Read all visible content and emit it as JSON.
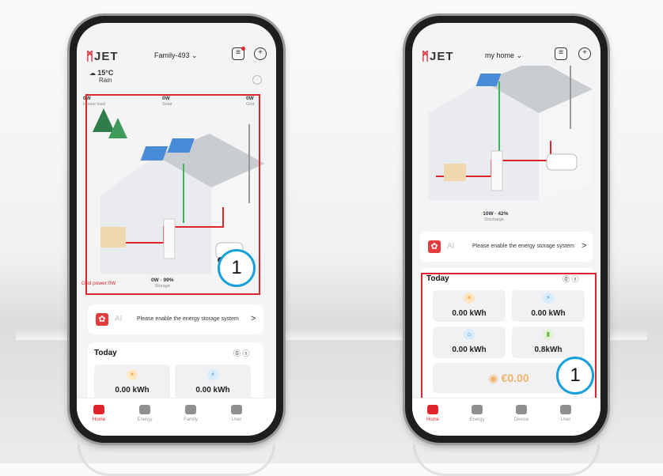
{
  "colors": {
    "accent": "#e0242c",
    "highlight_box": "#d9252e",
    "callout_ring": "#18a0d8",
    "solar_line": "#3fb45f"
  },
  "left": {
    "logo": "JET",
    "family": "Family-493",
    "weather": {
      "temp": "15°C",
      "cond": "Rain"
    },
    "flow": {
      "house_val": "0W",
      "house_lbl": "House load",
      "solar_val": "0W",
      "solar_lbl": "Solar",
      "grid_val": "0W",
      "grid_lbl": "Grid",
      "gridpower": "Grid power:0W",
      "storage_val": "0W · 99%",
      "storage_lbl": "Storage"
    },
    "callout": "1",
    "ai": {
      "label": "AI",
      "text": "Please enable the energy storage system",
      "chevron": ">"
    },
    "today": {
      "title": "Today",
      "stats": [
        "0.00 kWh",
        "0.00 kWh"
      ]
    },
    "nav": [
      "Home",
      "Energy",
      "Family",
      "User"
    ]
  },
  "right": {
    "logo": "JET",
    "family": "my home",
    "flow": {
      "storage_val": "10W · 42%",
      "storage_lbl": "Discharge"
    },
    "ai": {
      "label": "AI",
      "text": "Please enable the energy storage system",
      "chevron": ">"
    },
    "today": {
      "title": "Today",
      "stats": [
        "0.00 kWh",
        "0.00 kWh",
        "0.00 kWh",
        "0.8kWh"
      ],
      "money": "€0.00"
    },
    "callout": "1",
    "nav": [
      "Home",
      "Energy",
      "Device",
      "User"
    ]
  }
}
